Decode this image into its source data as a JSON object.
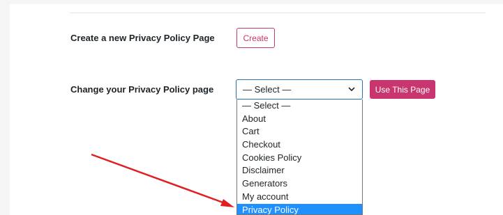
{
  "create_row": {
    "label": "Create a new Privacy Policy Page",
    "button_label": "Create"
  },
  "change_row": {
    "label": "Change your Privacy Policy page",
    "select_value": "— Select —",
    "button_label": "Use This Page"
  },
  "dropdown": {
    "options": [
      "— Select —",
      "About",
      "Cart",
      "Checkout",
      "Cookies Policy",
      "Disclaimer",
      "Generators",
      "My account",
      "Privacy Policy"
    ],
    "highlighted": "Privacy Policy"
  },
  "icons": {
    "select_caret": "chevron-down-icon",
    "annotation": "red-arrow-annotation"
  },
  "colors": {
    "accent": "#c9356e",
    "focus_border": "#2271b1",
    "highlight": "#1e90ff",
    "annotation_arrow": "#e02020"
  }
}
